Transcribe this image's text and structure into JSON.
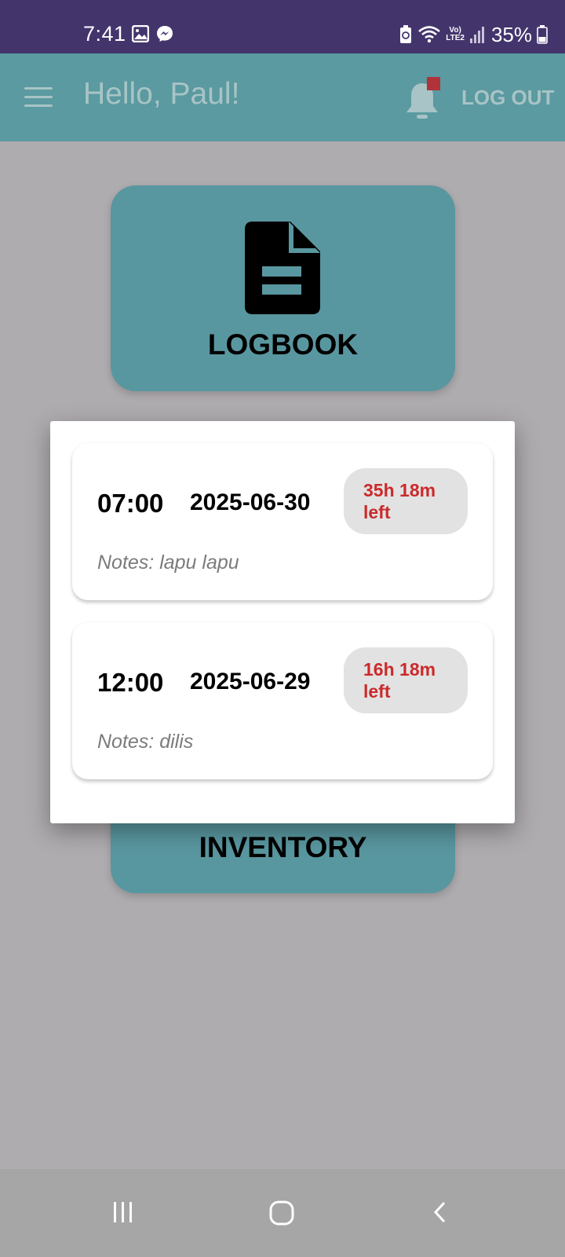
{
  "status_bar": {
    "time": "7:41",
    "lte_line1": "Vo)",
    "lte_line2": "LTE2",
    "battery_percent": "35%",
    "icons": [
      "gallery-icon",
      "messenger-icon",
      "battery-saver-icon",
      "wifi-icon",
      "signal-icon",
      "battery-icon"
    ]
  },
  "app_bar": {
    "title": "Hello, Paul!",
    "logout_label": "LOG OUT",
    "menu_icon": "menu-icon",
    "notification_icon": "bell-icon",
    "has_notification_badge": true
  },
  "menu": {
    "logbook_label": "LOGBOOK",
    "logbook_icon": "document-icon",
    "inventory_label": "INVENTORY"
  },
  "popup": {
    "entries": [
      {
        "time": "07:00",
        "date": "2025-06-30",
        "time_left_line1": "35h 18m",
        "time_left_line2": "left",
        "notes": "Notes: lapu lapu"
      },
      {
        "time": "12:00",
        "date": "2025-06-29",
        "time_left_line1": "16h 18m",
        "time_left_line2": "left",
        "notes": "Notes: dilis"
      }
    ]
  },
  "colors": {
    "status_bar": "#43356c",
    "app_bar": "#5a9aa0",
    "card": "#5997a0",
    "scrim_background": "#afacaf",
    "time_left_text": "#cb2a2b",
    "badge": "#b0333a"
  },
  "nav_bar": {
    "icons": [
      "recents-icon",
      "home-icon",
      "back-icon"
    ]
  }
}
